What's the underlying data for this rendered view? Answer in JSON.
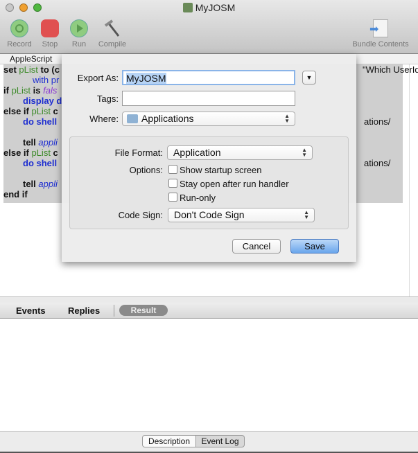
{
  "window": {
    "title": "MyJOSM"
  },
  "toolbar": {
    "record": "Record",
    "stop": "Stop",
    "run": "Run",
    "compile": "Compile",
    "bundle": "Bundle Contents"
  },
  "tab": "AppleScript",
  "code": {
    "left": [
      "set pList to (c",
      "with pr",
      "if pList is fals",
      "display d",
      "else if pList c",
      "do shell",
      "tell appli",
      "else if pList c",
      "do shell",
      "tell appli",
      "end if"
    ],
    "right": [
      "\"Which UserId?\"",
      "ations/",
      "ations/"
    ]
  },
  "dialog": {
    "export_label": "Export As:",
    "export_value": "MyJOSM",
    "tags_label": "Tags:",
    "tags_value": "",
    "where_label": "Where:",
    "where_value": "Applications",
    "format_label": "File Format:",
    "format_value": "Application",
    "options_label": "Options:",
    "options": [
      {
        "label": "Show startup screen",
        "checked": false
      },
      {
        "label": "Stay open after run handler",
        "checked": false
      },
      {
        "label": "Run-only",
        "checked": false
      }
    ],
    "codesign_label": "Code Sign:",
    "codesign_value": "Don't Code Sign",
    "cancel": "Cancel",
    "save": "Save"
  },
  "events": {
    "tabs": [
      "Events",
      "Replies",
      "Result"
    ],
    "active": "Result"
  },
  "bottom": {
    "tabs": [
      "Description",
      "Event Log"
    ],
    "active": "Event Log"
  },
  "colors": {
    "keyword": "#1b1b1b",
    "variable": "#3d8a2a",
    "command": "#1e2ed0",
    "accent": "#5b9ae8"
  }
}
